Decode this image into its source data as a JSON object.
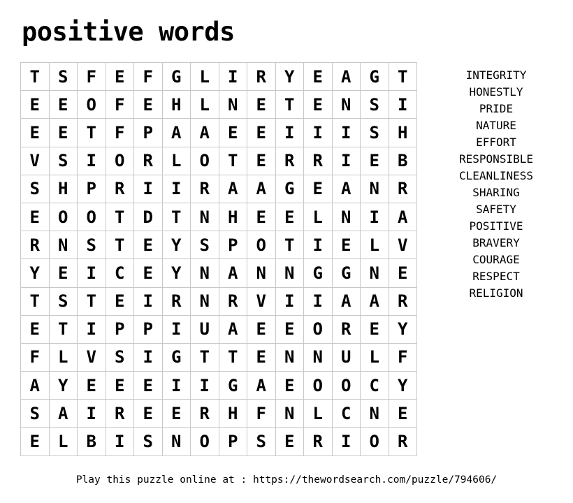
{
  "title": "positive words",
  "grid": [
    [
      "T",
      "S",
      "F",
      "E",
      "F",
      "G",
      "L",
      "I",
      "R",
      "Y",
      "E",
      "A",
      "G",
      "T"
    ],
    [
      "E",
      "E",
      "O",
      "F",
      "E",
      "H",
      "L",
      "N",
      "E",
      "T",
      "E",
      "N",
      "S",
      "I"
    ],
    [
      "E",
      "E",
      "T",
      "F",
      "P",
      "A",
      "A",
      "E",
      "E",
      "I",
      "I",
      "I",
      "S",
      "H"
    ],
    [
      "V",
      "S",
      "I",
      "O",
      "R",
      "L",
      "O",
      "T",
      "E",
      "R",
      "R",
      "I",
      "E",
      "B"
    ],
    [
      "S",
      "H",
      "P",
      "R",
      "I",
      "I",
      "R",
      "A",
      "A",
      "G",
      "E",
      "A",
      "N",
      "R"
    ],
    [
      "E",
      "O",
      "O",
      "T",
      "D",
      "T",
      "N",
      "H",
      "E",
      "E",
      "L",
      "N",
      "I",
      "A"
    ],
    [
      "R",
      "N",
      "S",
      "T",
      "E",
      "Y",
      "S",
      "P",
      "O",
      "T",
      "I",
      "E",
      "L",
      "V"
    ],
    [
      "Y",
      "E",
      "I",
      "C",
      "E",
      "Y",
      "N",
      "A",
      "N",
      "N",
      "G",
      "G",
      "N",
      "E"
    ],
    [
      "T",
      "S",
      "T",
      "E",
      "I",
      "R",
      "N",
      "R",
      "V",
      "I",
      "I",
      "A",
      "A",
      "R"
    ],
    [
      "E",
      "T",
      "I",
      "P",
      "P",
      "I",
      "U",
      "A",
      "E",
      "E",
      "O",
      "R",
      "E",
      "Y"
    ],
    [
      "F",
      "L",
      "V",
      "S",
      "I",
      "G",
      "T",
      "T",
      "E",
      "N",
      "N",
      "U",
      "L",
      "F"
    ],
    [
      "A",
      "Y",
      "E",
      "E",
      "E",
      "I",
      "I",
      "G",
      "A",
      "E",
      "O",
      "O",
      "C",
      "Y"
    ],
    [
      "S",
      "A",
      "I",
      "R",
      "E",
      "E",
      "R",
      "H",
      "F",
      "N",
      "L",
      "C",
      "N",
      "E"
    ],
    [
      "E",
      "L",
      "B",
      "I",
      "S",
      "N",
      "O",
      "P",
      "S",
      "E",
      "R",
      "I",
      "O",
      "R"
    ]
  ],
  "words": [
    "INTEGRITY",
    "HONESTLY",
    "PRIDE",
    "NATURE",
    "EFFORT",
    "RESPONSIBLE",
    "CLEANLINESS",
    "SHARING",
    "SAFETY",
    "POSITIVE",
    "BRAVERY",
    "COURAGE",
    "RESPECT",
    "RELIGION"
  ],
  "footer": "Play this puzzle online at : https://thewordsearch.com/puzzle/794606/"
}
